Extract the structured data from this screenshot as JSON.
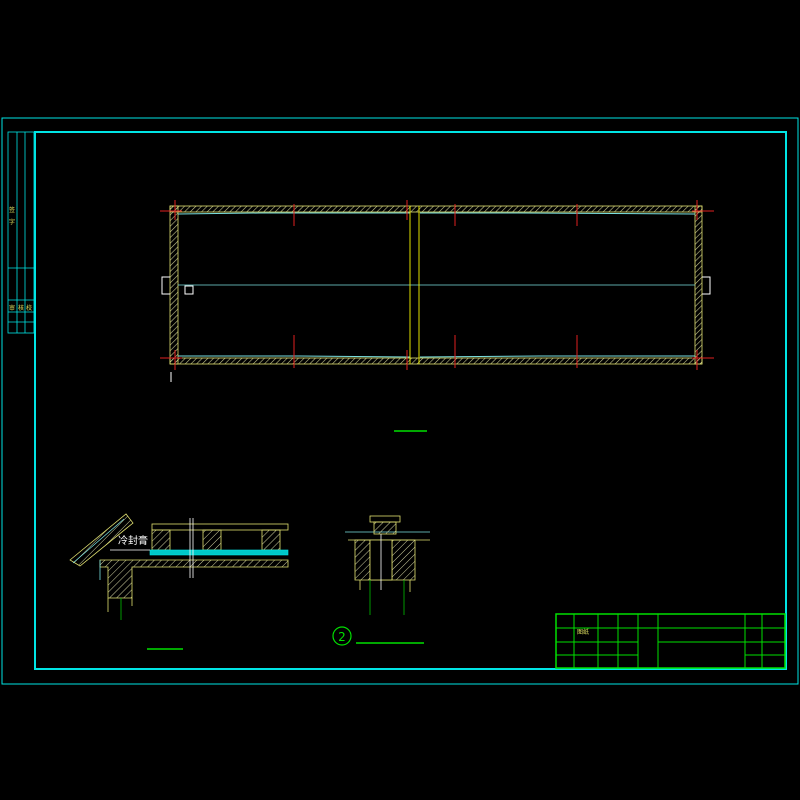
{
  "drawing": {
    "colors": {
      "background": "#000000",
      "frame": "#00e5e5",
      "wall": "#e0e070",
      "hatch": "#c8c890",
      "axis": "#e02020",
      "centerline": "#e0e000",
      "center_h": "#7ae0e0",
      "title_underline": "#00e000",
      "titleblock": "#00e000",
      "detail_cyan": "#00e5e5",
      "detail_green": "#00c000",
      "text": "#ffffff"
    },
    "detail_callout": {
      "symbol": "2",
      "label": ""
    },
    "section_text": "冷封膏",
    "titleblock": {
      "cell_text": "图纸"
    },
    "left_strip": {
      "labels": [
        "签",
        "字",
        "审",
        "核",
        "校"
      ]
    }
  }
}
